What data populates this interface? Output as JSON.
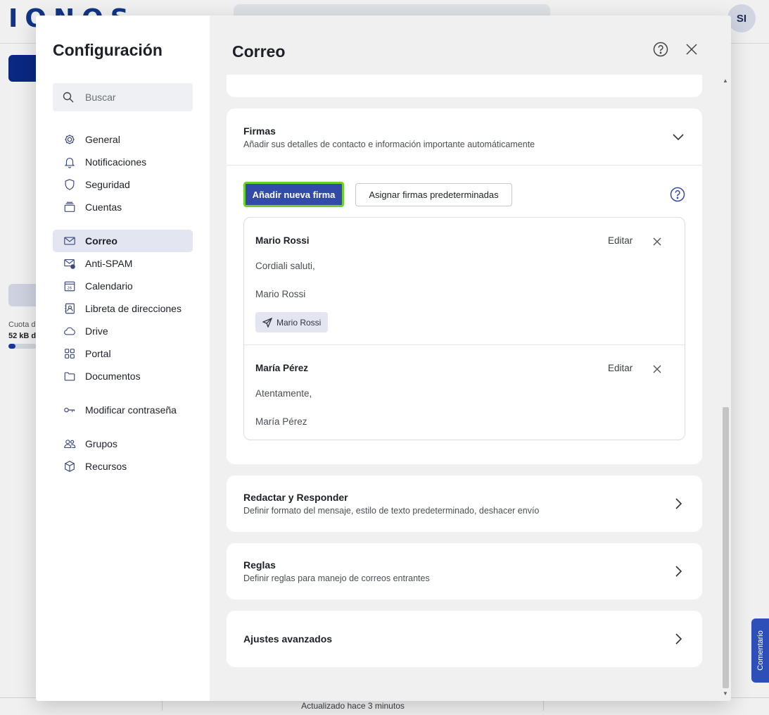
{
  "background": {
    "logo": "IONOS",
    "avatar": "SI",
    "quota_label": "Cuota d",
    "quota_value": "52 kB d",
    "status": "Actualizado hace 3 minutos",
    "feedback": "Comentario"
  },
  "settings": {
    "title": "Configuración",
    "search_placeholder": "Buscar",
    "nav": [
      {
        "label": "General",
        "icon": "gear-icon"
      },
      {
        "label": "Notificaciones",
        "icon": "bell-icon"
      },
      {
        "label": "Seguridad",
        "icon": "shield-icon"
      },
      {
        "label": "Cuentas",
        "icon": "accounts-icon"
      },
      {
        "label": "Correo",
        "icon": "mail-icon",
        "active": true
      },
      {
        "label": "Anti-SPAM",
        "icon": "antispam-icon"
      },
      {
        "label": "Calendario",
        "icon": "calendar-icon"
      },
      {
        "label": "Libreta de direcciones",
        "icon": "addressbook-icon"
      },
      {
        "label": "Drive",
        "icon": "cloud-icon"
      },
      {
        "label": "Portal",
        "icon": "grid-icon"
      },
      {
        "label": "Documentos",
        "icon": "folder-icon"
      },
      {
        "label": "Modificar contraseña",
        "icon": "key-icon"
      },
      {
        "label": "Grupos",
        "icon": "groups-icon"
      },
      {
        "label": "Recursos",
        "icon": "cube-icon"
      }
    ]
  },
  "main": {
    "title": "Correo",
    "signatures": {
      "title": "Firmas",
      "subtitle": "Añadir sus detalles de contacto e información importante automáticamente",
      "add_button": "Añadir nueva firma",
      "assign_button": "Asignar firmas predeterminadas",
      "items": [
        {
          "name": "Mario Rossi",
          "edit": "Editar",
          "lines": [
            "Cordiali saluti,",
            "Mario Rossi"
          ],
          "chip": "Mario Rossi"
        },
        {
          "name": "María Pérez",
          "edit": "Editar",
          "lines": [
            "Atentamente,",
            "María Pérez"
          ]
        }
      ]
    },
    "sections": [
      {
        "title": "Redactar y Responder",
        "subtitle": "Definir formato del mensaje, estilo de texto predeterminado, deshacer envío"
      },
      {
        "title": "Reglas",
        "subtitle": "Definir reglas para manejo de correos entrantes"
      },
      {
        "title": "Ajustes avanzados",
        "subtitle": ""
      }
    ]
  }
}
